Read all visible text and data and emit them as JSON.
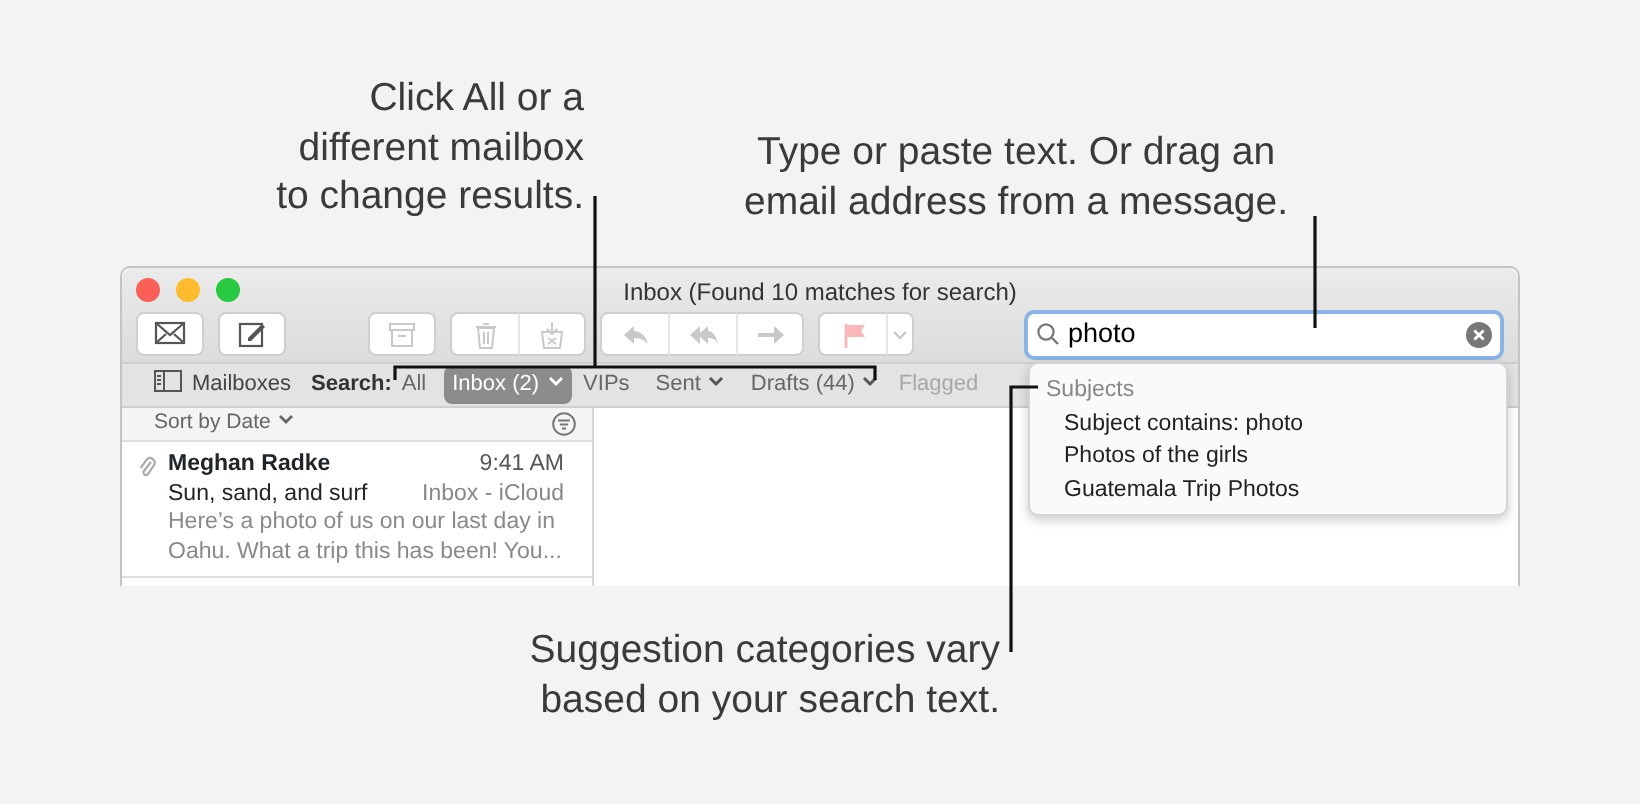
{
  "callouts": [
    {
      "kind": "favorites",
      "lines": [
        "Click All or a",
        "different mailbox",
        "to change results."
      ]
    },
    {
      "kind": "search",
      "lines": [
        "Type or paste text. Or drag an",
        "email address from a message."
      ]
    },
    {
      "kind": "suggestions",
      "lines": [
        "Suggestion categories vary",
        "based on your search text."
      ]
    }
  ],
  "window": {
    "title": "Inbox (Found 10 matches for search)"
  },
  "toolbar": [
    [
      {
        "kind": "get-mail",
        "disabled": false
      }
    ],
    [
      {
        "kind": "compose",
        "disabled": false
      }
    ],
    [
      {
        "kind": "archive",
        "disabled": true
      }
    ],
    [
      {
        "kind": "delete",
        "disabled": true
      },
      {
        "kind": "junk",
        "disabled": true
      }
    ],
    [
      {
        "kind": "reply",
        "disabled": true
      },
      {
        "kind": "reply-all",
        "disabled": true
      },
      {
        "kind": "forward",
        "disabled": true
      }
    ],
    [
      {
        "kind": "flag",
        "disabled": true
      },
      {
        "kind": "menu",
        "disabled": true
      }
    ]
  ],
  "search": {
    "value": "photo"
  },
  "favorites_bar": {
    "mailboxes": "Mailboxes",
    "search_label": "Search:",
    "items": [
      {
        "label": "All",
        "selected": false,
        "dropdown": false,
        "disabled": false
      },
      {
        "label": "Inbox (2)",
        "selected": true,
        "dropdown": true,
        "disabled": false
      },
      {
        "label": "VIPs",
        "selected": false,
        "dropdown": false,
        "disabled": false
      },
      {
        "label": "Sent",
        "selected": false,
        "dropdown": true,
        "disabled": false
      },
      {
        "label": "Drafts (44)",
        "selected": false,
        "dropdown": true,
        "disabled": false
      },
      {
        "label": "Flagged",
        "selected": false,
        "dropdown": false,
        "disabled": true
      }
    ]
  },
  "sort": "Sort by Date",
  "messages": [
    {
      "sender": "Meghan Radke",
      "time": "9:41 AM",
      "subject": "Sun, sand, and surf",
      "mailbox": "Inbox - iCloud",
      "preview": "Here’s a photo of us on our last day in Oahu. What a trip this has been! You...",
      "attachment": true
    }
  ],
  "suggestions": {
    "heading": "Subjects",
    "items": [
      "Subject contains: photo",
      "Photos of the girls",
      "Guatemala Trip Photos"
    ]
  }
}
